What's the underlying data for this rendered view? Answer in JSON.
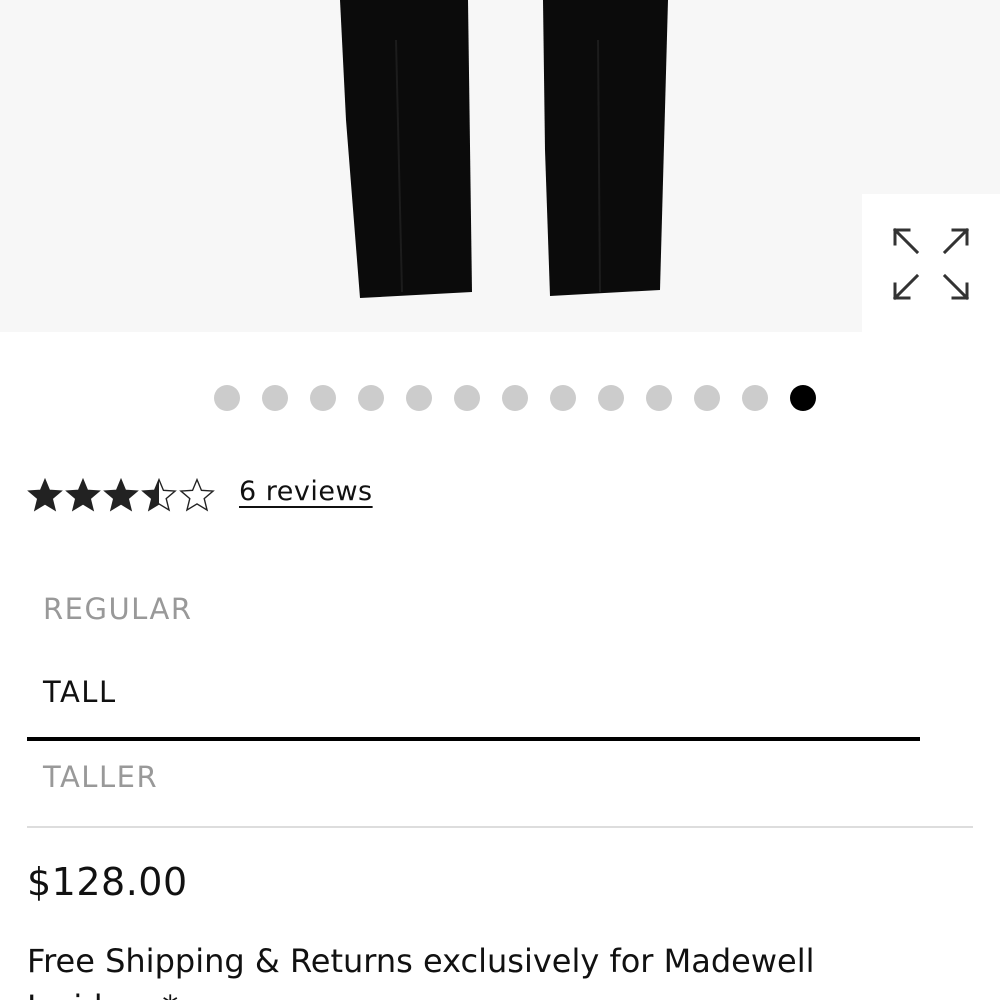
{
  "product": {
    "carousel": {
      "total_images": 13,
      "active_index": 12
    },
    "rating": {
      "stars": 3.5,
      "out_of": 5,
      "reviews_label": "6 reviews"
    },
    "sizes": [
      {
        "label": "REGULAR",
        "selected": false
      },
      {
        "label": "TALL",
        "selected": true
      },
      {
        "label": "TALLER",
        "selected": false
      }
    ],
    "price": "$128.00",
    "shipping_text": "Free Shipping & Returns exclusively for Madewell Insiders.*"
  },
  "icons": {
    "expand": "expand-arrows-icon",
    "star": "star-icon"
  },
  "colors": {
    "active_dot": "#000000",
    "inactive_dot": "#cccccc",
    "unselected_size": "#999999",
    "selected_size": "#111111"
  }
}
